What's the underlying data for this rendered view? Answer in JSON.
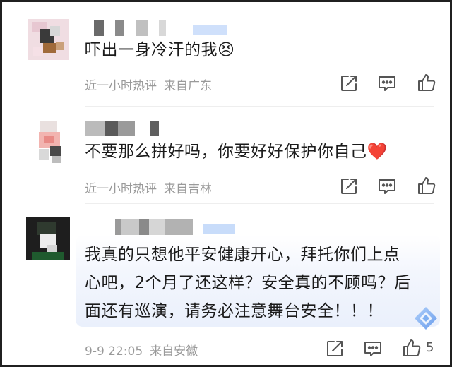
{
  "comments": [
    {
      "text": "吓出一身冷汗的我😣",
      "time": "近一小时热评",
      "location": "来自广东",
      "like_count": ""
    },
    {
      "text": "不要那么拼好吗，你要好好保护你自己❤️",
      "time": "近一小时热评",
      "location": "来自吉林",
      "like_count": ""
    },
    {
      "text_lines": [
        "我真的只想他平安健康开心，拜托你们上点",
        "心吧，2个月了还这样？安全真的不顾吗？后",
        "面还有巡演，请务必注意舞台安全！！！"
      ],
      "time": "9-9 22:05",
      "location": "来自安徽",
      "like_count": "5"
    }
  ],
  "icons": {
    "share": "share-icon",
    "reply": "comment-icon",
    "like": "thumb-up-icon",
    "badge": "hot-comment-badge-icon"
  },
  "colors": {
    "meta_text": "#9a9a9a",
    "icon": "#555555",
    "highlight_blue": "#eaf0fc",
    "heart_red": "#e53935",
    "badge_blue": "#6ba6f2"
  }
}
